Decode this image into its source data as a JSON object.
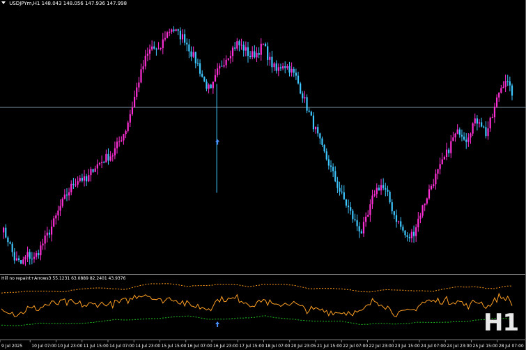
{
  "header": {
    "symbol": "USDJPYm,H1",
    "ohlc": "148.043 148.056 147.936 147.998"
  },
  "indicator_label": "Hill no repaint+Arrows3 55.1231 63.0889 82.2401 43.9376",
  "timeframe_badge": "H1",
  "colors": {
    "background": "#000000",
    "bull_candle": "#ff2fd6",
    "bear_candle": "#3ec6ff",
    "price_line": "#7d8fa0",
    "arrow": "#4a90ff",
    "osc_main": "#ffa024",
    "osc_upper": "#ff9a1a",
    "osc_lower": "#20c020",
    "text": "#ffffff"
  },
  "chart_data": {
    "type": "candlestick",
    "symbol": "USDJPYm",
    "timeframe": "H1",
    "x_labels": [
      "9 Jul 2025",
      "10 Jul 07:00",
      "10 Jul 23:00",
      "11 Jul 15:00",
      "14 Jul 07:00",
      "14 Jul 23:00",
      "15 Jul 15:00",
      "16 Jul 07:00",
      "16 Jul 23:00",
      "17 Jul 15:00",
      "18 Jul 07:00",
      "20 Jul 23:05",
      "21 Jul 15:00",
      "22 Jul 07:00",
      "22 Jul 23:00",
      "23 Jul 15:00",
      "24 Jul 07:00",
      "24 Jul 23:00",
      "25 Jul 15:00",
      "28 Jul 07:00"
    ],
    "ylim": [
      145.9,
      149.2
    ],
    "current_price": 147.998,
    "closes": [
      146.45,
      146.3,
      146.05,
      145.98,
      146.1,
      146.05,
      146.2,
      146.35,
      146.52,
      146.72,
      146.88,
      147.02,
      147.1,
      147.04,
      147.22,
      147.28,
      147.35,
      147.4,
      147.56,
      147.72,
      148.02,
      148.35,
      148.62,
      148.78,
      148.7,
      148.92,
      149.02,
      148.94,
      148.88,
      148.7,
      148.55,
      148.32,
      148.2,
      148.45,
      148.6,
      148.72,
      148.82,
      148.76,
      148.66,
      148.7,
      148.8,
      148.6,
      148.46,
      148.56,
      148.5,
      148.38,
      148.16,
      147.92,
      147.7,
      147.46,
      147.28,
      147.06,
      146.86,
      146.7,
      146.52,
      146.4,
      146.6,
      146.92,
      147.0,
      146.86,
      146.62,
      146.46,
      146.3,
      146.4,
      146.64,
      146.86,
      147.06,
      147.22,
      147.4,
      147.6,
      147.7,
      147.6,
      147.78,
      147.85,
      147.66,
      147.88,
      148.2,
      148.37,
      148.15
    ],
    "arrows": [
      {
        "x_index": 33,
        "price": 147.59
      }
    ],
    "oscillator": {
      "name": "Hill no repaint+Arrows3",
      "values": [
        55.1231,
        63.0889,
        82.2401,
        43.9376
      ]
    }
  }
}
